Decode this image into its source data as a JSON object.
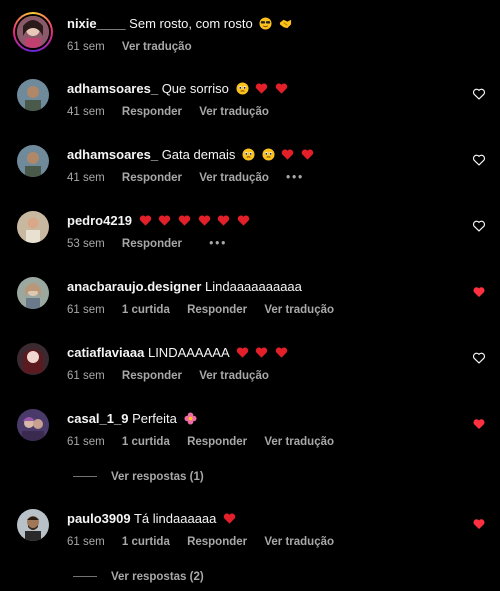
{
  "colors": {
    "bg": "#000000",
    "text": "#f5f5f5",
    "muted": "#a8a8a8",
    "liked": "#ff3040"
  },
  "comments": [
    {
      "user": "nixie____",
      "text": "Sem rosto, com rosto",
      "emojis": [
        "sunglasses-face-emoji",
        "handshake-emoji"
      ],
      "time": "61 sem",
      "likes": "",
      "reply": "",
      "translate": "Ver tradução",
      "more": "",
      "heart": "none"
    },
    {
      "user": "adhamsoares_",
      "text": "Que sorriso",
      "emojis": [
        "pleading-face-emoji",
        "red-heart-emoji",
        "red-heart-emoji"
      ],
      "time": "41 sem",
      "likes": "",
      "reply": "Responder",
      "translate": "Ver tradução",
      "more": "",
      "heart": "outline"
    },
    {
      "user": "adhamsoares_",
      "text": "Gata demais",
      "emojis": [
        "pleading-face-emoji",
        "pleading-face-emoji",
        "red-heart-emoji",
        "red-heart-emoji"
      ],
      "time": "41 sem",
      "likes": "",
      "reply": "Responder",
      "translate": "Ver tradução",
      "more": "•••",
      "heart": "outline"
    },
    {
      "user": "pedro4219",
      "text": "",
      "emojis": [
        "red-heart-emoji",
        "red-heart-emoji",
        "red-heart-emoji",
        "red-heart-emoji",
        "red-heart-emoji",
        "red-heart-emoji"
      ],
      "time": "53 sem",
      "likes": "",
      "reply": "Responder",
      "translate": "",
      "more": "•••",
      "heart": "outline"
    },
    {
      "user": "anacbaraujo.designer",
      "text": "Lindaaaaaaaaaa",
      "emojis": [],
      "time": "61 sem",
      "likes": "1 curtida",
      "reply": "Responder",
      "translate": "Ver tradução",
      "more": "",
      "heart": "filled"
    },
    {
      "user": "catiaflaviaaa",
      "text": "LINDAAAAAA",
      "emojis": [
        "red-heart-emoji",
        "red-heart-emoji",
        "red-heart-emoji"
      ],
      "time": "61 sem",
      "likes": "",
      "reply": "Responder",
      "translate": "Ver tradução",
      "more": "",
      "heart": "outline"
    },
    {
      "user": "casal_1_9",
      "text": "Perfeita",
      "emojis": [
        "flower-emoji"
      ],
      "time": "61 sem",
      "likes": "1 curtida",
      "reply": "Responder",
      "translate": "Ver tradução",
      "more": "",
      "heart": "filled"
    },
    {
      "user": "paulo3909",
      "text": "Tá lindaaaaaa",
      "emojis": [
        "red-heart-emoji"
      ],
      "time": "61 sem",
      "likes": "1 curtida",
      "reply": "Responder",
      "translate": "Ver tradução",
      "more": "",
      "heart": "filled"
    }
  ],
  "replies_links": [
    {
      "label": "Ver respostas (1)"
    },
    {
      "label": "Ver respostas (2)"
    }
  ]
}
